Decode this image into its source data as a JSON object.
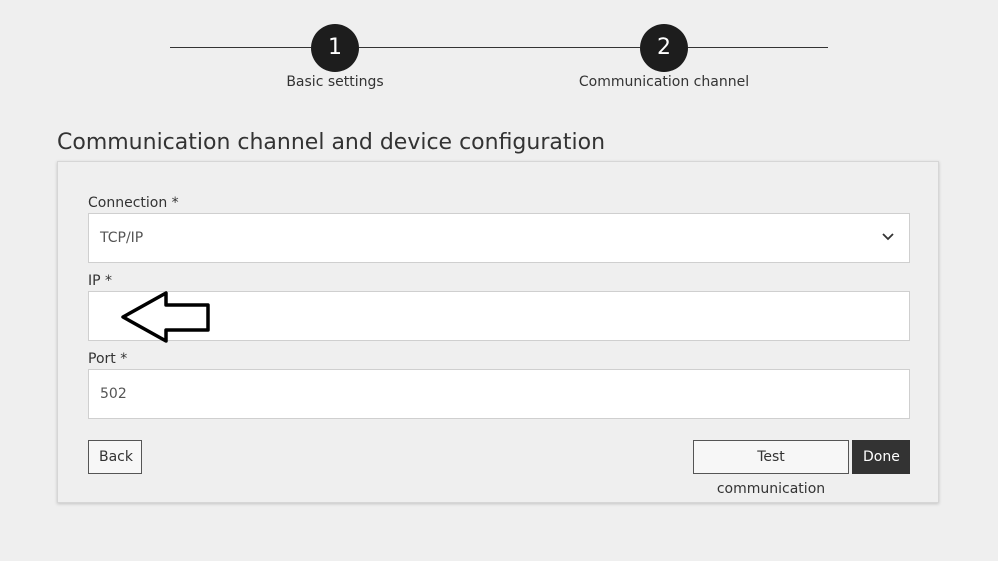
{
  "stepper": {
    "steps": [
      {
        "number": "1",
        "label": "Basic settings"
      },
      {
        "number": "2",
        "label": "Communication channel"
      }
    ]
  },
  "page": {
    "title": "Communication channel and device configuration"
  },
  "form": {
    "connection": {
      "label": "Connection *",
      "value": "TCP/IP"
    },
    "ip": {
      "label": "IP *",
      "value": ""
    },
    "port": {
      "label": "Port *",
      "value": "502"
    }
  },
  "buttons": {
    "back": "Back",
    "test": "Test communication",
    "done": "Done"
  },
  "icons": {
    "dropdown": "chevron-down-icon",
    "annotation": "arrow-left-icon"
  },
  "colors": {
    "background": "#efefef",
    "step_circle": "#1d1d1d",
    "primary_button": "#333333"
  }
}
